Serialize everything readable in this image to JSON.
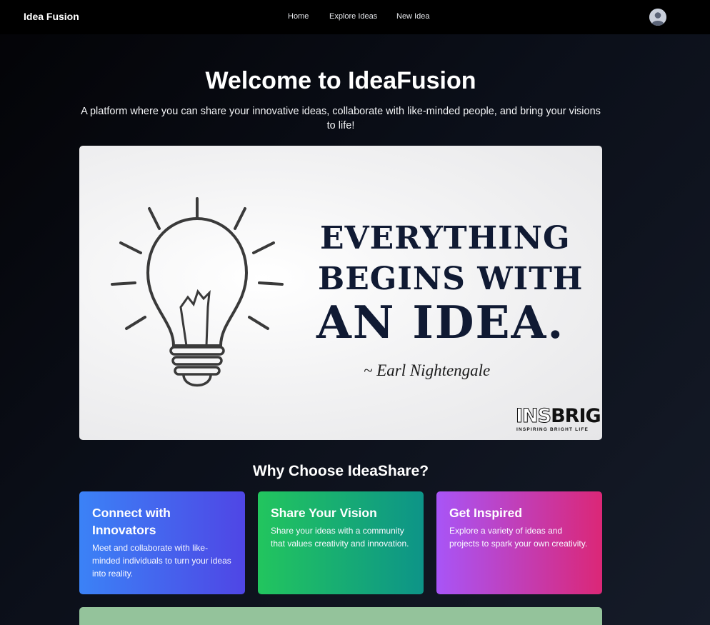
{
  "nav": {
    "brand": "Idea Fusion",
    "links": [
      "Home",
      "Explore Ideas",
      "New Idea"
    ],
    "avatar_icon": "user-avatar-icon"
  },
  "hero": {
    "title": "Welcome to IdeaFusion",
    "subtitle": "A platform where you can share your innovative ideas, collaborate with like-minded people, and bring your visions to life!",
    "image": {
      "quote_lines": [
        "EVERYTHING",
        "BEGINS WITH",
        "AN IDEA."
      ],
      "author": "~ Earl Nightengale",
      "logo_ins": "INS",
      "logo_bright": "BRIGHT",
      "logo_tagline": "INSPIRING BRIGHT LIFE",
      "icon": "lightbulb-icon"
    }
  },
  "why": {
    "title": "Why Choose IdeaShare?",
    "cards": [
      {
        "title": "Connect with Innovators",
        "text": "Meet and collaborate with like-minded individuals to turn your ideas into reality.",
        "colors": [
          "#3b82f6",
          "#4f46e5"
        ]
      },
      {
        "title": "Share Your Vision",
        "text": "Share your ideas with a community that values creativity and innovation.",
        "colors": [
          "#22c55e",
          "#0d9488"
        ]
      },
      {
        "title": "Get Inspired",
        "text": "Explore a variety of ideas and projects to spark your own creativity.",
        "colors": [
          "#a855f7",
          "#db2777"
        ]
      }
    ]
  },
  "colors": {
    "navbar": "#000000",
    "background": "#0b0f19",
    "bottom_panel": "#94c39b"
  }
}
